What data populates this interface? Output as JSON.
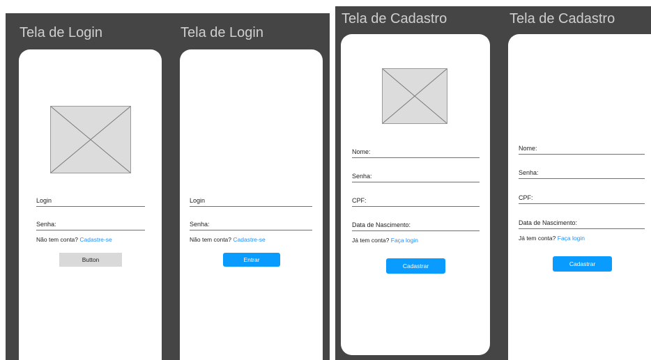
{
  "boards": {
    "login": {
      "title_a": "Tela de Login",
      "title_b": "Tela de Login"
    },
    "cadastro": {
      "title_a": "Tela de Cadastro",
      "title_b": "Tela de Cadastro"
    }
  },
  "login_screen_1": {
    "login_label": "Login",
    "password_label": "Senha:",
    "signup_prompt": "Não tem conta?",
    "signup_link": "Cadastre-se",
    "button_label": "Button"
  },
  "login_screen_2": {
    "login_label": "Login",
    "password_label": "Senha:",
    "signup_prompt": "Não tem conta?",
    "signup_link": "Cadastre-se",
    "button_label": "Entrar"
  },
  "signup_screen_1": {
    "name_label": "Nome:",
    "password_label": "Senha:",
    "cpf_label": "CPF:",
    "birth_label": "Data de Nascimento:",
    "login_prompt": "Já tem conta?",
    "login_link": "Faça login",
    "button_label": "Cadastrar"
  },
  "signup_screen_2": {
    "name_label": "Nome:",
    "password_label": "Senha:",
    "cpf_label": "CPF:",
    "birth_label": "Data de Nascimento:",
    "login_prompt": "Já tem conta?",
    "login_link": "Faça login",
    "button_label": "Cadastrar"
  },
  "colors": {
    "board_bg": "#454545",
    "accent_blue": "#0a9bff",
    "link_blue": "#1e90ff"
  }
}
